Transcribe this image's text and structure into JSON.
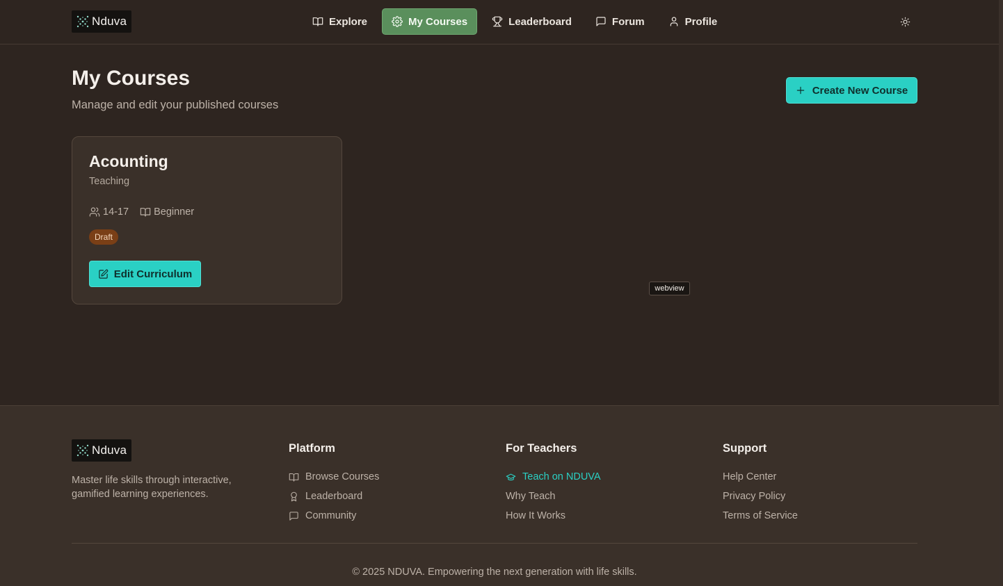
{
  "brand": {
    "name": "Nduva"
  },
  "nav": {
    "items": [
      {
        "label": "Explore",
        "icon": "book-open-icon"
      },
      {
        "label": "My Courses",
        "icon": "gear-icon",
        "active": true
      },
      {
        "label": "Leaderboard",
        "icon": "trophy-icon"
      },
      {
        "label": "Forum",
        "icon": "chat-bubble-icon"
      },
      {
        "label": "Profile",
        "icon": "user-icon"
      }
    ],
    "theme_toggle_icon": "sun-icon"
  },
  "main": {
    "title": "My Courses",
    "subtitle": "Manage and edit your published courses",
    "create_button_label": "Create New Course",
    "courses": [
      {
        "title": "Acounting",
        "category": "Teaching",
        "age_range": "14-17",
        "level": "Beginner",
        "status": "Draft",
        "edit_label": "Edit Curriculum"
      }
    ]
  },
  "overlay": {
    "webview_label": "webview"
  },
  "footer": {
    "tagline": "Master life skills through interactive, gamified learning experiences.",
    "columns": [
      {
        "title": "Platform",
        "links": [
          {
            "label": "Browse Courses",
            "icon": "book-open-icon"
          },
          {
            "label": "Leaderboard",
            "icon": "award-icon"
          },
          {
            "label": "Community",
            "icon": "chat-bubble-icon"
          }
        ]
      },
      {
        "title": "For Teachers",
        "links": [
          {
            "label": "Teach on NDUVA",
            "icon": "graduation-cap-icon"
          },
          {
            "label": "Why Teach"
          },
          {
            "label": "How It Works"
          }
        ]
      },
      {
        "title": "Support",
        "links": [
          {
            "label": "Help Center"
          },
          {
            "label": "Privacy Policy"
          },
          {
            "label": "Terms of Service"
          }
        ]
      }
    ],
    "copyright": "© 2025 NDUVA. Empowering the next generation with life skills."
  },
  "colors": {
    "background": "#2e2520",
    "accent_teal": "#2ad0c4",
    "nav_active_green": "#5a8f5c",
    "draft_badge": "#7a3f16"
  }
}
